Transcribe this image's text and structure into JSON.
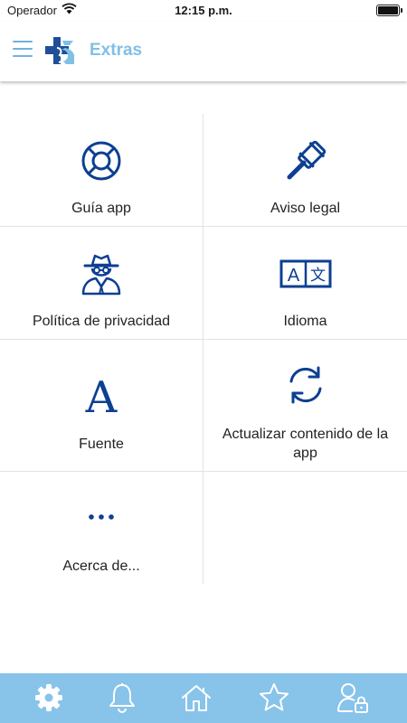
{
  "status_bar": {
    "carrier": "Operador",
    "time": "12:15 p.m."
  },
  "header": {
    "title": "Extras"
  },
  "items": [
    {
      "label": "Guía app",
      "icon": "lifebuoy-icon"
    },
    {
      "label": "Aviso legal",
      "icon": "gavel-icon"
    },
    {
      "label": "Política de privacidad",
      "icon": "spy-icon"
    },
    {
      "label": "Idioma",
      "icon": "translate-icon"
    },
    {
      "label": "Fuente",
      "icon": "font-icon"
    },
    {
      "label": "Actualizar contenido de la app",
      "icon": "refresh-icon"
    },
    {
      "label": "Acerca de...",
      "icon": "more-icon"
    }
  ],
  "tabbar": {
    "tabs": [
      "settings-icon",
      "bell-icon",
      "home-icon",
      "star-icon",
      "user-lock-icon"
    ]
  },
  "colors": {
    "accent": "#7fc0e6",
    "icon_blue": "#0d3f92",
    "tabbar": "#88c3ea"
  }
}
